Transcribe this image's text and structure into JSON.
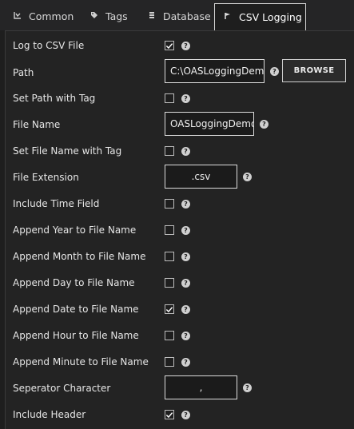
{
  "tabs": [
    {
      "label": "Common",
      "icon": "common-icon"
    },
    {
      "label": "Tags",
      "icon": "tag-icon"
    },
    {
      "label": "Database",
      "icon": "database-icon"
    },
    {
      "label": "CSV Logging",
      "icon": "csv-logging-icon"
    }
  ],
  "active_tab": "CSV Logging",
  "fields": {
    "log_to_csv": {
      "label": "Log to CSV File",
      "checked": true
    },
    "path": {
      "label": "Path",
      "value": "C:\\OASLoggingDemo",
      "button": "BROWSE"
    },
    "set_path_with_tag": {
      "label": "Set Path with Tag",
      "checked": false
    },
    "file_name": {
      "label": "File Name",
      "value": "OASLoggingDemo"
    },
    "set_file_name_with_tag": {
      "label": "Set File Name with Tag",
      "checked": false
    },
    "file_extension": {
      "label": "File Extension",
      "value": ".csv"
    },
    "include_time_field": {
      "label": "Include Time Field",
      "checked": false
    },
    "append_year": {
      "label": "Append Year to File Name",
      "checked": false
    },
    "append_month": {
      "label": "Append Month to File Name",
      "checked": false
    },
    "append_day": {
      "label": "Append Day to File Name",
      "checked": false
    },
    "append_date": {
      "label": "Append Date to File Name",
      "checked": true
    },
    "append_hour": {
      "label": "Append Hour to File Name",
      "checked": false
    },
    "append_minute": {
      "label": "Append Minute to File Name",
      "checked": false
    },
    "separator": {
      "label": "Seperator Character",
      "value": ","
    },
    "include_header": {
      "label": "Include Header",
      "checked": true
    }
  },
  "help_symbol": "?"
}
